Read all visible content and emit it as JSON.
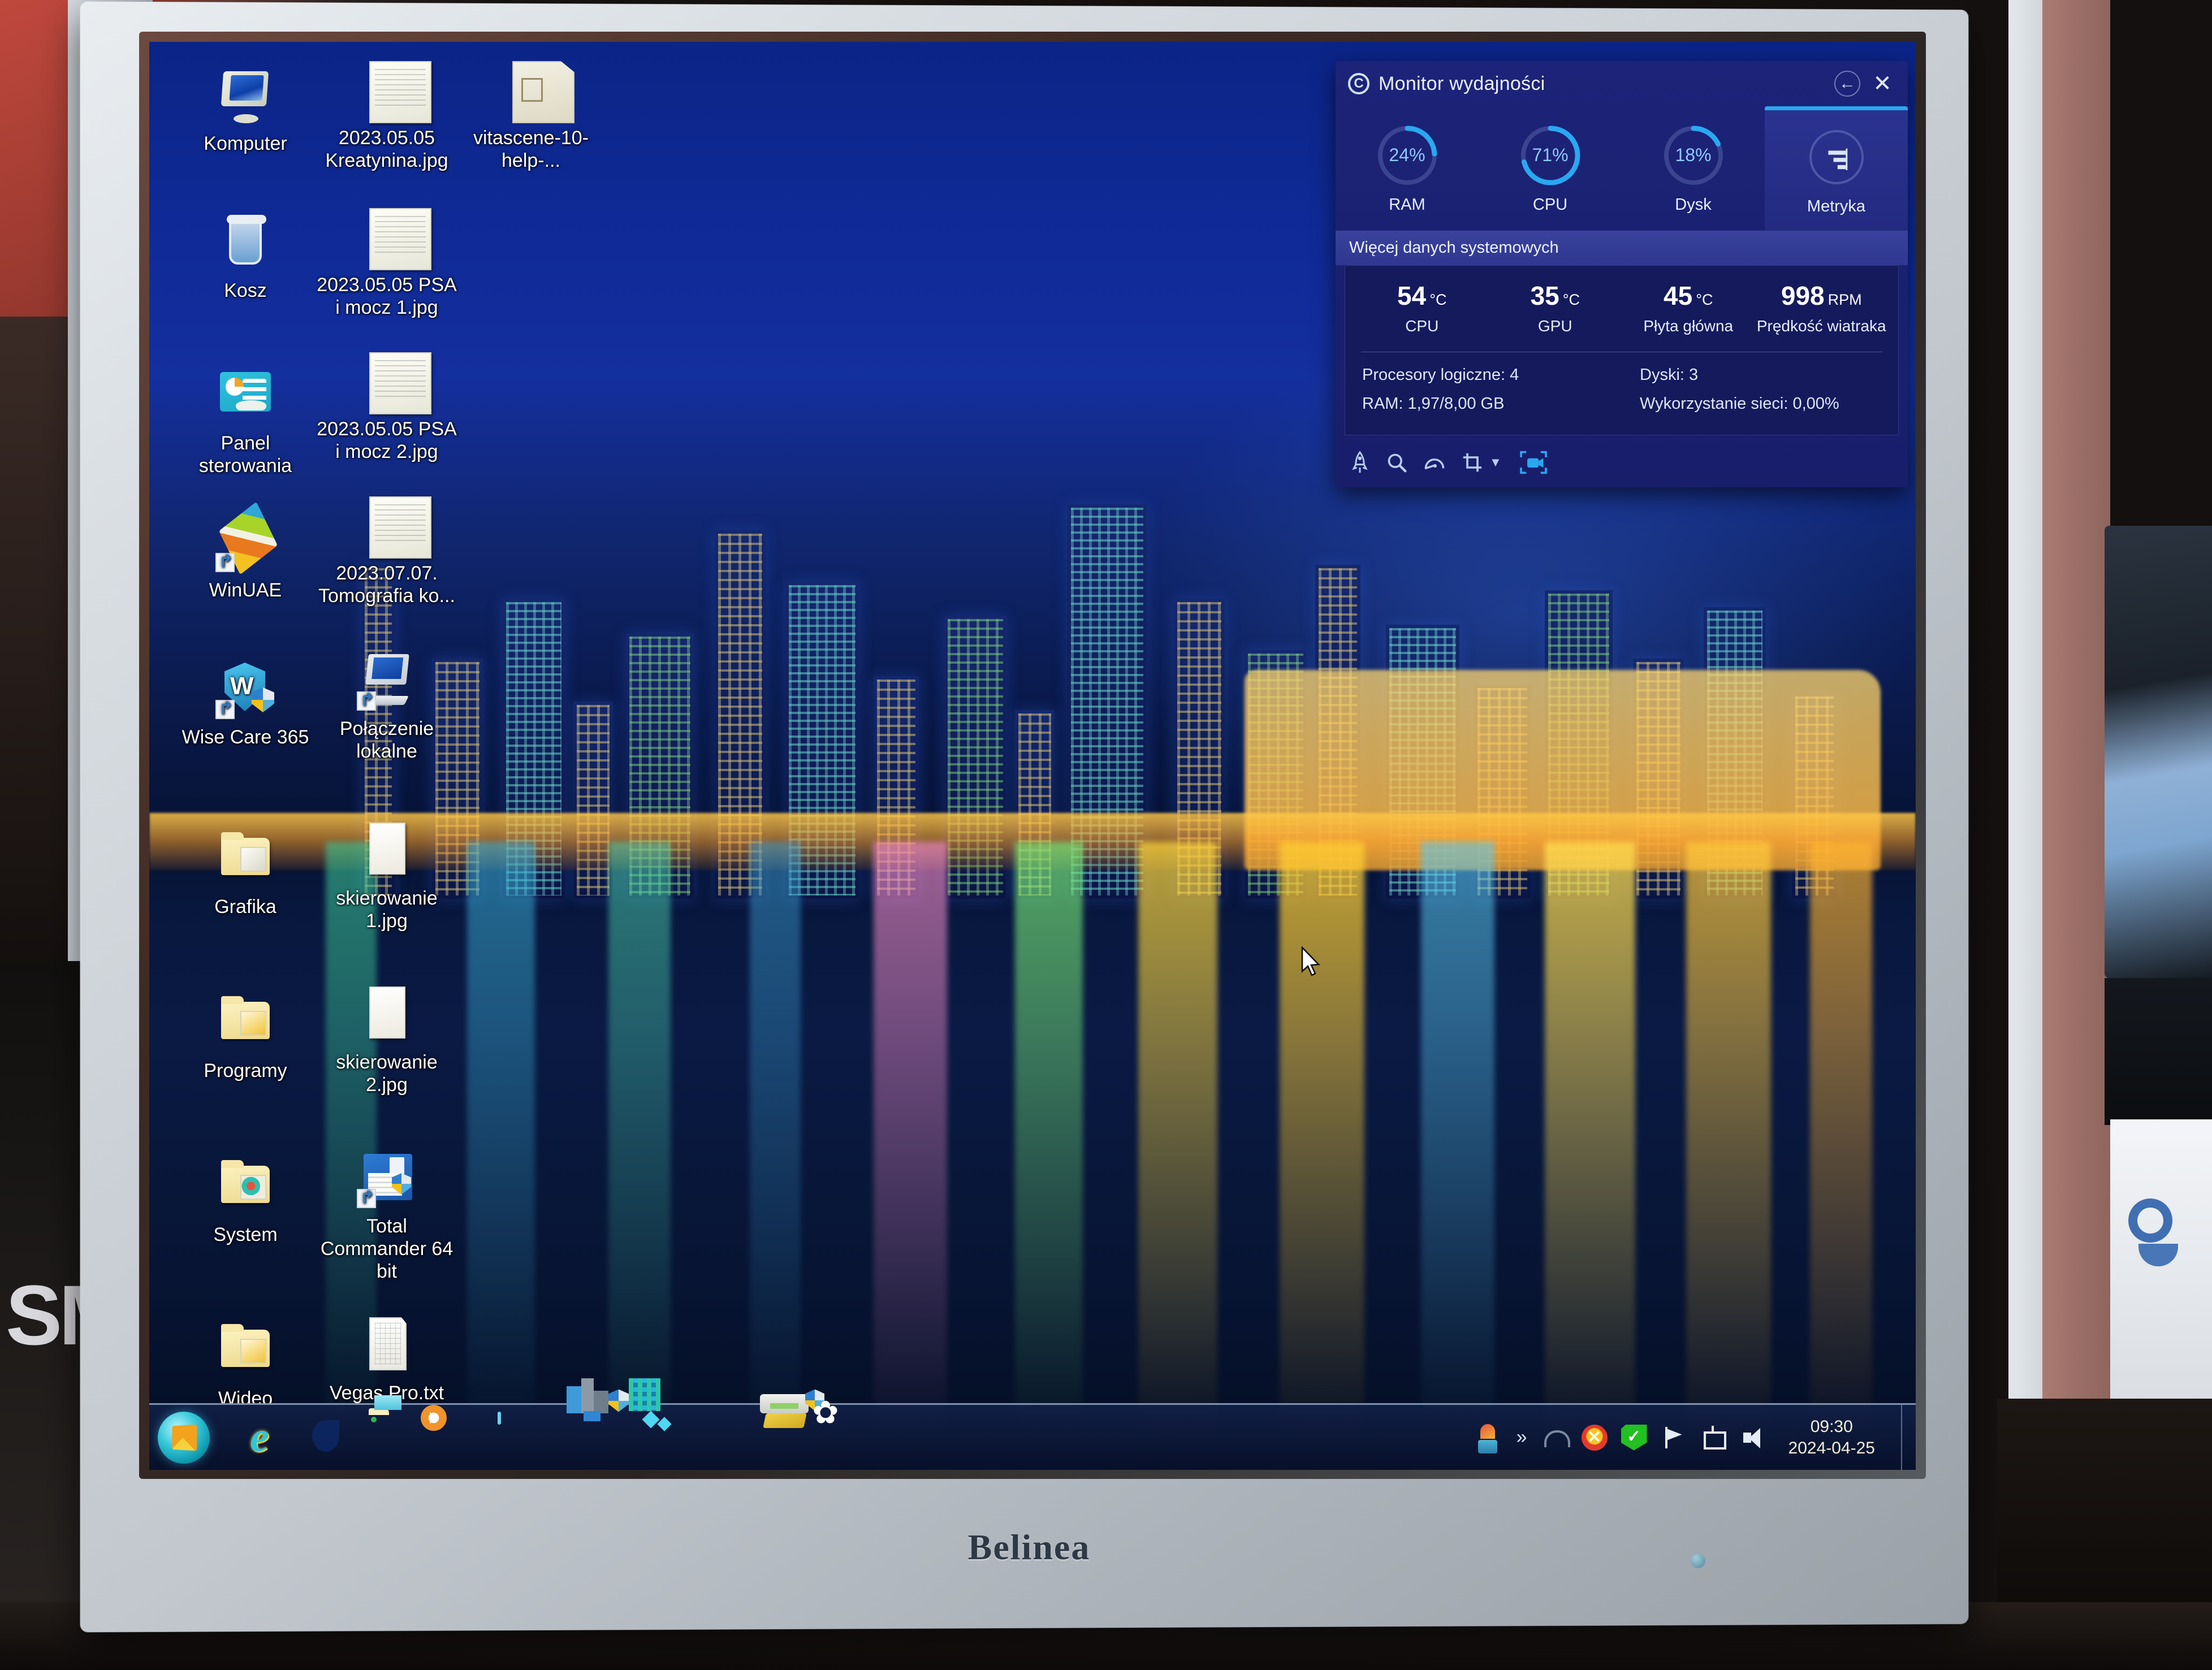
{
  "hardware": {
    "monitor_brand": "Belinea"
  },
  "desktop": {
    "icons": [
      {
        "label": "Komputer",
        "kind": "computer"
      },
      {
        "label": "2023.05.05 Kreatynina.jpg",
        "kind": "doc"
      },
      {
        "label": "vitascene-10-help-...",
        "kind": "odt"
      },
      {
        "label": "Kosz",
        "kind": "trash"
      },
      {
        "label": "2023.05.05 PSA i mocz 1.jpg",
        "kind": "doc"
      },
      {
        "label": "Panel sterowania",
        "kind": "panel"
      },
      {
        "label": "2023.05.05 PSA i mocz 2.jpg",
        "kind": "doc"
      },
      {
        "label": "WinUAE",
        "kind": "winuae"
      },
      {
        "label": "2023.07.07. Tomografia ko...",
        "kind": "doc"
      },
      {
        "label": "Wise Care 365",
        "kind": "wise"
      },
      {
        "label": "Połączenie lokalne",
        "kind": "net"
      },
      {
        "label": "Grafika",
        "kind": "folder-gfx"
      },
      {
        "label": "skierowanie 1.jpg",
        "kind": "doc-blank"
      },
      {
        "label": "Programy",
        "kind": "folder-prg"
      },
      {
        "label": "skierowanie 2.jpg",
        "kind": "doc-blank"
      },
      {
        "label": "System",
        "kind": "folder-sys"
      },
      {
        "label": "Total Commander 64 bit",
        "kind": "tc"
      },
      {
        "label": "Wideo",
        "kind": "folder-vid"
      },
      {
        "label": "Vegas Pro.txt",
        "kind": "txt"
      }
    ]
  },
  "perf_panel": {
    "title": "Monitor wydajności",
    "logo_glyph": "C",
    "back_label": "←",
    "close_label": "✕",
    "gauges": [
      {
        "label": "RAM",
        "value": "24%",
        "percent": 24,
        "active": false
      },
      {
        "label": "CPU",
        "value": "71%",
        "percent": 71,
        "active": false
      },
      {
        "label": "Dysk",
        "value": "18%",
        "percent": 18,
        "active": false
      },
      {
        "label": "Metryka",
        "value": "",
        "percent": 0,
        "active": true,
        "icon": "bar-chart-icon"
      }
    ],
    "section_header": "Więcej danych systemowych",
    "temps": [
      {
        "value": "54",
        "unit": "°C",
        "name": "CPU"
      },
      {
        "value": "35",
        "unit": "°C",
        "name": "GPU"
      },
      {
        "value": "45",
        "unit": "°C",
        "name": "Płyta główna"
      },
      {
        "value": "998",
        "unit": "RPM",
        "name": "Prędkość wiatraka"
      }
    ],
    "stats_left": [
      "Procesory logiczne: 4",
      "RAM: 1,97/8,00 GB"
    ],
    "stats_right": [
      "Dyski: 3",
      "Wykorzystanie sieci: 0,00%"
    ],
    "toolbar_icons": [
      "rocket-icon",
      "search-icon",
      "gauge-icon",
      "crop-icon",
      "chevron-down-icon",
      "record-icon"
    ],
    "accent_color": "#29a8f0",
    "panel_bg_color": "#1d2378"
  },
  "taskbar": {
    "start_label": "Start",
    "pinned": [
      "internet-explorer-icon",
      "microsoft-edge-icon",
      "file-explorer-icon",
      "windows-media-player-icon",
      "calculator-icon",
      "city-app-icon",
      "wise-care-icon",
      "firefox-icon",
      "scanner-icon",
      "gear-tools-icon"
    ],
    "tray": {
      "overflow_label": "»",
      "icons": [
        "tray-app-icon",
        "wifi-icon",
        "antivirus-warning-icon",
        "green-check-icon",
        "flag-icon",
        "network-icon",
        "volume-icon"
      ],
      "time": "09:30",
      "date": "2024-04-25"
    }
  }
}
